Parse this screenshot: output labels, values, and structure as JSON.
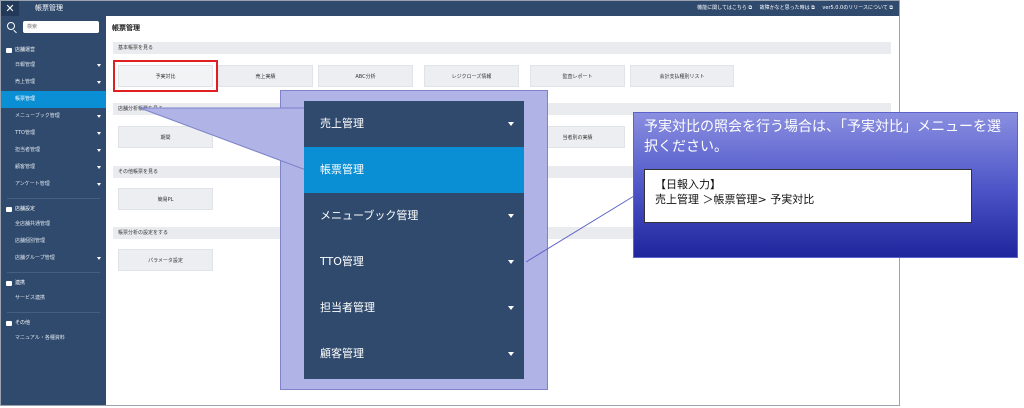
{
  "topbar": {
    "close_label": "✕",
    "title": "帳票管理",
    "links": [
      "機能に関してはこちら ⧉",
      "故障かなと思った時は ⧉",
      "ver5.0.0のリリースについて ⧉"
    ]
  },
  "sidebar": {
    "search_placeholder": "検索",
    "groups": [
      {
        "label": "店舗運営",
        "items": [
          {
            "label": "日報管理",
            "caret": true
          },
          {
            "label": "売上管理",
            "caret": true
          },
          {
            "label": "帳票管理",
            "active": true
          },
          {
            "label": "メニューブック管理",
            "caret": true
          },
          {
            "label": "TTO管理",
            "caret": true
          },
          {
            "label": "担当者管理",
            "caret": true
          },
          {
            "label": "顧客管理",
            "caret": true
          },
          {
            "label": "アンケート管理",
            "caret": true
          }
        ]
      },
      {
        "label": "店舗設定",
        "items": [
          {
            "label": "全店舗共通管理"
          },
          {
            "label": "店舗個別管理"
          },
          {
            "label": "店舗グループ管理",
            "caret": true
          }
        ]
      },
      {
        "label": "連携",
        "items": [
          {
            "label": "サービス連携"
          }
        ]
      },
      {
        "label": "その他",
        "items": [
          {
            "label": "マニュアル・各種資料"
          }
        ]
      }
    ]
  },
  "main": {
    "page_title": "帳票管理",
    "sections": [
      {
        "label": "基本帳票を見る",
        "tiles": [
          "予実対比",
          "売上実績",
          "ABC分析",
          "レジクローズ情報",
          "監査レポート",
          "会計支払種別リスト"
        ]
      },
      {
        "label": "店舗分析帳票を見る",
        "tiles": [
          "期間",
          "当者別の実績"
        ]
      },
      {
        "label": "その他帳票を見る",
        "tiles": [
          "簡易PL"
        ]
      },
      {
        "label": "帳票分析の設定をする",
        "tiles": [
          "パラメータ設定"
        ]
      }
    ]
  },
  "callout_menu": {
    "items": [
      {
        "label": "売上管理",
        "caret": true
      },
      {
        "label": "帳票管理",
        "active": true
      },
      {
        "label": "メニューブック管理",
        "caret": true
      },
      {
        "label": "TTO管理",
        "caret": true
      },
      {
        "label": "担当者管理",
        "caret": true
      },
      {
        "label": "顧客管理",
        "caret": true
      }
    ]
  },
  "note": {
    "heading": "予実対比の照会を行う場合は、「予実対比」メニューを選択ください。",
    "path_title": "【日報入力】",
    "path": "売上管理 ＞帳票管理> 予実対比"
  },
  "colors": {
    "sidebar_bg": "#2f4a6d",
    "active_blue": "#0a8ed4",
    "highlight_red": "#e02020",
    "callout_frame": "#b0b3e6",
    "note_gradient_dark": "#1f259c"
  }
}
